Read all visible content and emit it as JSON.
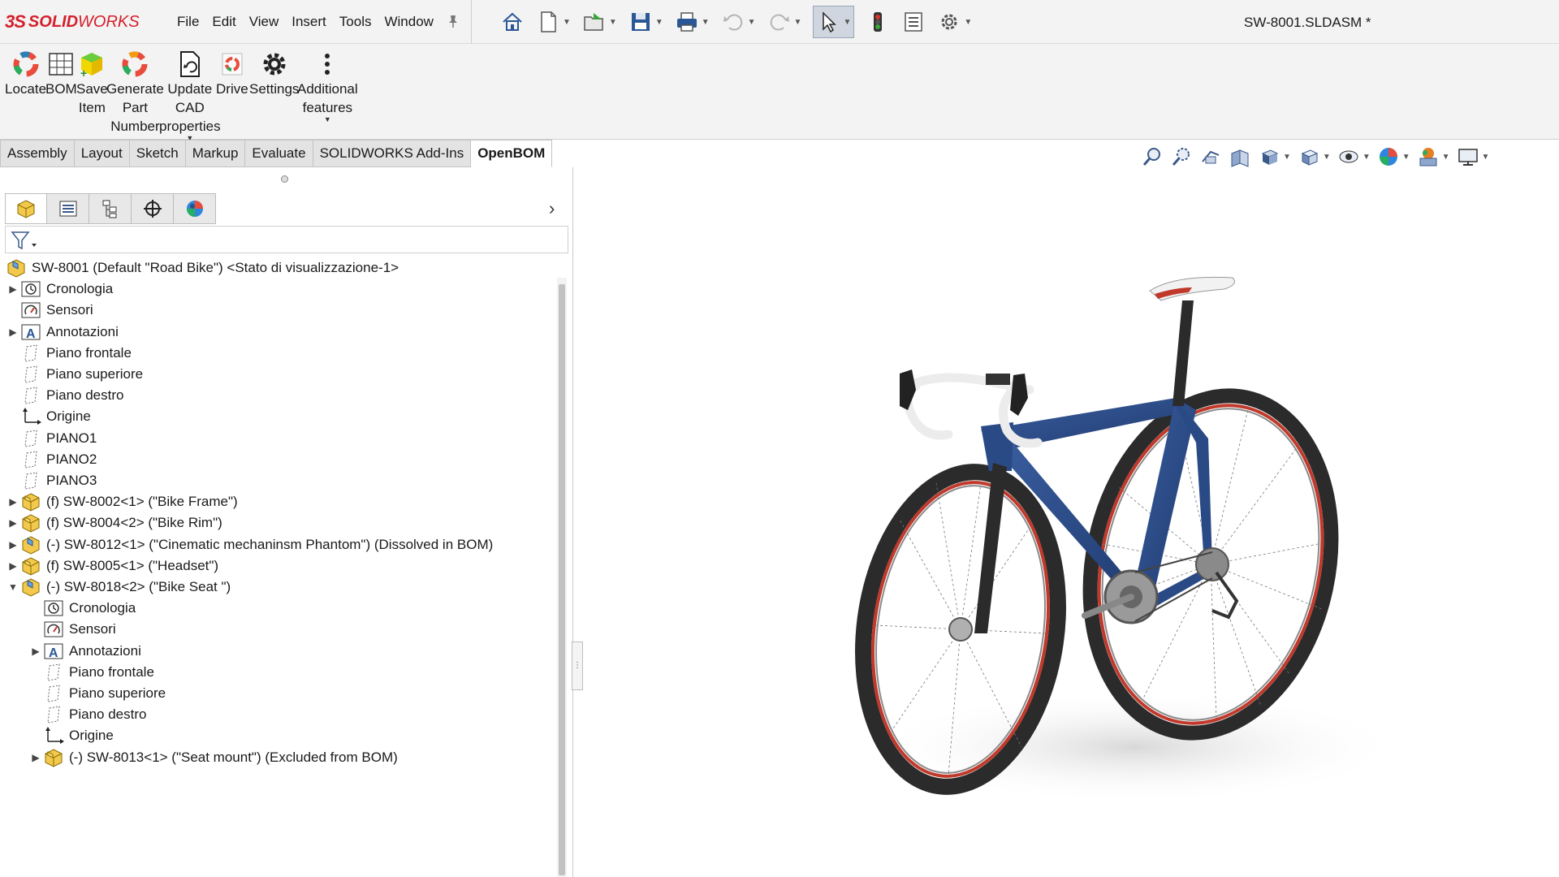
{
  "app": {
    "brand_ds": "3S",
    "brand_solid": "SOLID",
    "brand_works": "WORKS",
    "document_title": "SW-8001.SLDASM *"
  },
  "menu": [
    "File",
    "Edit",
    "View",
    "Insert",
    "Tools",
    "Window"
  ],
  "quick_access": [
    {
      "icon": "home-icon",
      "dropdown": false
    },
    {
      "icon": "new-document-icon",
      "dropdown": true
    },
    {
      "icon": "open-icon",
      "dropdown": true
    },
    {
      "icon": "save-icon",
      "dropdown": true
    },
    {
      "icon": "print-icon",
      "dropdown": true
    },
    {
      "icon": "undo-icon",
      "dropdown": true
    },
    {
      "icon": "redo-icon",
      "dropdown": true
    },
    {
      "icon": "select-pointer-icon",
      "dropdown": true
    },
    {
      "icon": "traffic-light-icon",
      "dropdown": false
    },
    {
      "icon": "file-properties-icon",
      "dropdown": false
    },
    {
      "icon": "options-gear-icon",
      "dropdown": true
    }
  ],
  "ribbon": [
    {
      "label": "Locate",
      "icon": "openbom-ring-icon"
    },
    {
      "label": "BOM",
      "icon": "bom-grid-icon"
    },
    {
      "label": "Save\nItem",
      "icon": "save-item-cube-icon"
    },
    {
      "label": "Generate\nPart\nNumber",
      "icon": "openbom-ring-icon"
    },
    {
      "label": "Update\nCAD\nproperties",
      "icon": "update-document-icon"
    },
    {
      "label": "Drive",
      "icon": "drive-icon"
    },
    {
      "label": "Settings",
      "icon": "settings-gear-icon"
    },
    {
      "label": "Additional\nfeatures",
      "icon": "more-vertical-icon"
    }
  ],
  "tabs": [
    "Assembly",
    "Layout",
    "Sketch",
    "Markup",
    "Evaluate",
    "SOLIDWORKS Add-Ins",
    "OpenBOM"
  ],
  "active_tab": "OpenBOM",
  "hud_icons": [
    "zoom-to-fit-icon",
    "zoom-to-area-icon",
    "previous-view-icon",
    "section-view-icon",
    "view-orientation-icon",
    "display-style-icon",
    "hide-show-items-icon",
    "edit-appearance-icon",
    "apply-scene-icon",
    "view-settings-icon"
  ],
  "panel_tabs": [
    "featuremanager-tree-icon",
    "propertymanager-icon",
    "configurationmanager-icon",
    "dimxpert-icon",
    "displaymanager-icon"
  ],
  "tree": [
    {
      "label": "SW-8001 (Default \"Road Bike\") <Stato di visualizzazione-1>",
      "icon": "assembly-icon",
      "level": 0,
      "arrow": ""
    },
    {
      "label": "Cronologia",
      "icon": "history-icon",
      "level": 1,
      "arrow": "▶"
    },
    {
      "label": "Sensori",
      "icon": "sensor-icon",
      "level": 1,
      "arrow": ""
    },
    {
      "label": "Annotazioni",
      "icon": "annotation-icon",
      "level": 1,
      "arrow": "▶"
    },
    {
      "label": "Piano frontale",
      "icon": "plane-icon",
      "level": 1,
      "arrow": ""
    },
    {
      "label": "Piano superiore",
      "icon": "plane-icon",
      "level": 1,
      "arrow": ""
    },
    {
      "label": "Piano destro",
      "icon": "plane-icon",
      "level": 1,
      "arrow": ""
    },
    {
      "label": "Origine",
      "icon": "origin-icon",
      "level": 1,
      "arrow": ""
    },
    {
      "label": "PIANO1",
      "icon": "plane-icon",
      "level": 1,
      "arrow": ""
    },
    {
      "label": "PIANO2",
      "icon": "plane-icon",
      "level": 1,
      "arrow": ""
    },
    {
      "label": "PIANO3",
      "icon": "plane-icon",
      "level": 1,
      "arrow": ""
    },
    {
      "label": "(f) SW-8002<1> (\"Bike Frame\")",
      "icon": "part-icon",
      "level": 1,
      "arrow": "▶"
    },
    {
      "label": "(f) SW-8004<2> (\"Bike Rim\")",
      "icon": "part-icon",
      "level": 1,
      "arrow": "▶"
    },
    {
      "label": "(-) SW-8012<1> (\"Cinematic mechaninsm Phantom\") (Dissolved in BOM)",
      "icon": "subassembly-icon",
      "level": 1,
      "arrow": "▶"
    },
    {
      "label": "(f) SW-8005<1> (\"Headset\")",
      "icon": "part-icon",
      "level": 1,
      "arrow": "▶"
    },
    {
      "label": "(-) SW-8018<2> (\"Bike Seat \")",
      "icon": "subassembly-icon",
      "level": 1,
      "arrow": "▼"
    },
    {
      "label": "Cronologia",
      "icon": "history-icon",
      "level": 2,
      "arrow": ""
    },
    {
      "label": "Sensori",
      "icon": "sensor-icon",
      "level": 2,
      "arrow": ""
    },
    {
      "label": "Annotazioni",
      "icon": "annotation-icon",
      "level": 2,
      "arrow": "▶"
    },
    {
      "label": "Piano frontale",
      "icon": "plane-icon",
      "level": 2,
      "arrow": ""
    },
    {
      "label": "Piano superiore",
      "icon": "plane-icon",
      "level": 2,
      "arrow": ""
    },
    {
      "label": "Piano destro",
      "icon": "plane-icon",
      "level": 2,
      "arrow": ""
    },
    {
      "label": "Origine",
      "icon": "origin-icon",
      "level": 2,
      "arrow": ""
    },
    {
      "label": "(-) SW-8013<1> (\"Seat mount\") (Excluded from BOM)",
      "icon": "part-icon",
      "level": 2,
      "arrow": "▶"
    }
  ],
  "colors": {
    "brand_red": "#d4202c",
    "frame_blue": "#2a4a86",
    "rim_red": "#c0392b",
    "tire": "#2b2b2b"
  }
}
